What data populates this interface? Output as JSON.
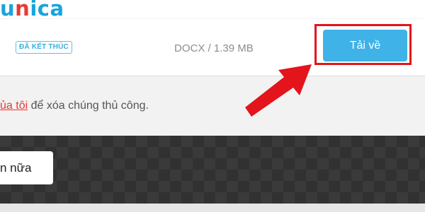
{
  "header": {
    "logo_part1": "u",
    "logo_part2": "n",
    "logo_part3": "ica"
  },
  "file_card": {
    "status_badge": "ĐÃ KẾT THÚC",
    "file_info": "DOCX / 1.39 MB",
    "download_label": "Tải về"
  },
  "notice": {
    "link_text": "ủa tôi",
    "text": " để xóa chúng thủ công."
  },
  "more_button_label": "n nữa",
  "colors": {
    "accent_blue": "#3fb2e8",
    "highlight_red": "#e3141b"
  }
}
